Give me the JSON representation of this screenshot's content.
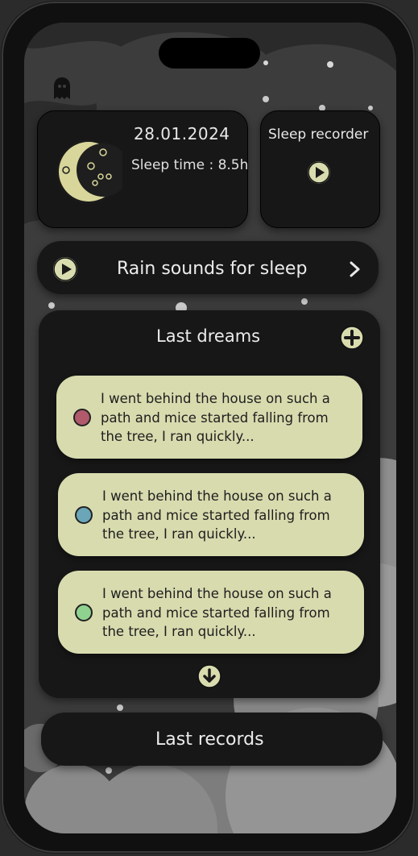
{
  "theme": {
    "accent": "#d9dcae",
    "card_bg": "#171717",
    "text": "#ececec"
  },
  "header": {
    "icon": "ghost-icon"
  },
  "sleep_card": {
    "date": "28.01.2024",
    "sleep_time": "Sleep time : 8.5h",
    "icon": "moon-icon"
  },
  "recorder": {
    "label": "Sleep recorder",
    "icon": "play-icon"
  },
  "rain": {
    "label": "Rain sounds for sleep",
    "icon": "play-icon",
    "chevron": "chevron-right-icon"
  },
  "dreams": {
    "title": "Last dreams",
    "add_icon": "plus-icon",
    "items": [
      {
        "text": "I went behind the house on such a path and mice started falling from the tree, I ran quickly...",
        "color": "#b05a6c"
      },
      {
        "text": "I went behind the house on such a path and mice started falling from the tree, I ran quickly...",
        "color": "#6aa6b8"
      },
      {
        "text": "I went behind the house on such a path and mice started falling from the tree, I ran quickly...",
        "color": "#8fd28f"
      }
    ],
    "more_icon": "arrow-down-icon"
  },
  "records": {
    "label": "Last records"
  }
}
